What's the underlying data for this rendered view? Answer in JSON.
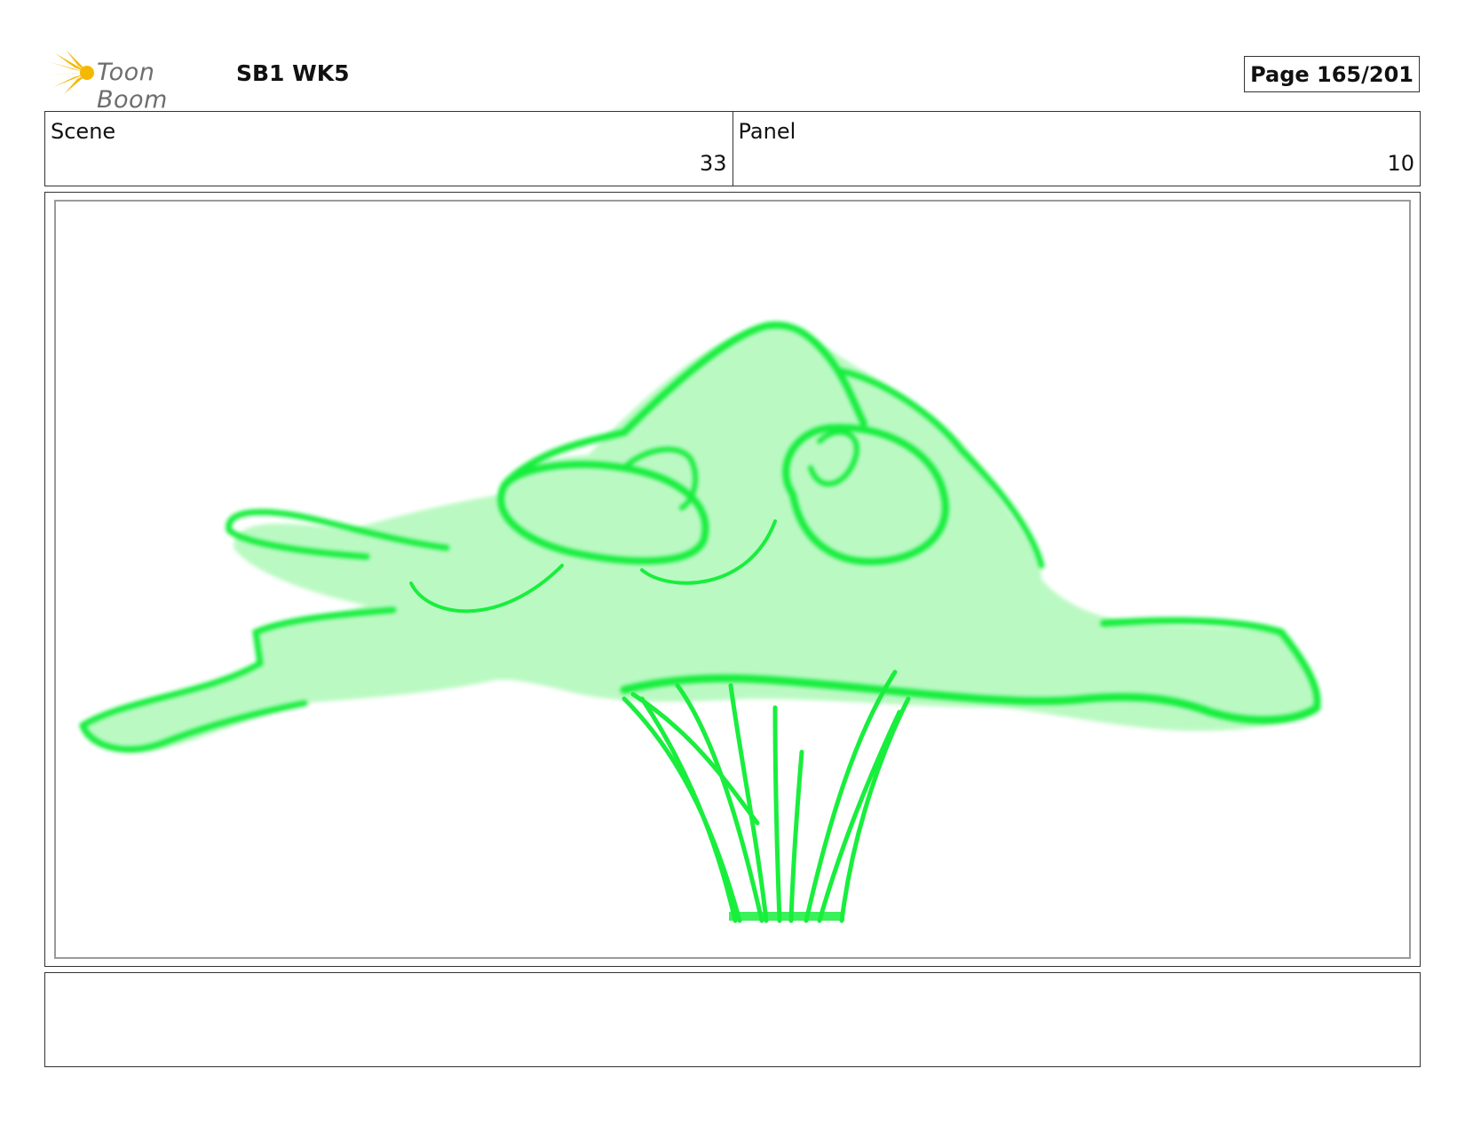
{
  "header": {
    "logo_text": "Toon Boom",
    "project": "SB1 WK5",
    "page": "Page 165/201"
  },
  "info": {
    "scene_label": "Scene",
    "scene_value": "33",
    "panel_label": "Panel",
    "panel_value": "10"
  },
  "drawing": {
    "subject": "tree",
    "stroke_color": "#19ee3d",
    "fill_color": "#b8f9c0"
  },
  "notes": {
    "text": ""
  }
}
